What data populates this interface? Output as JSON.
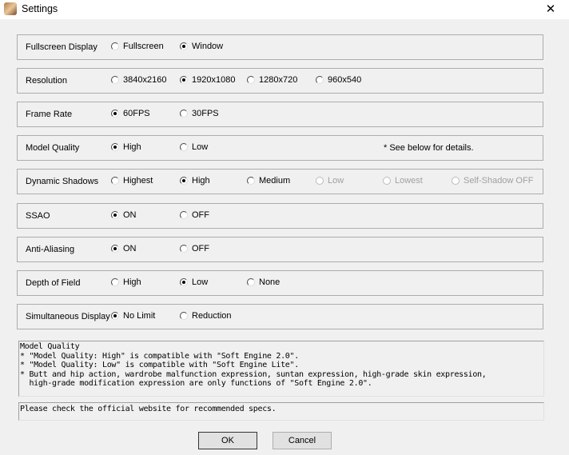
{
  "window": {
    "title": "Settings",
    "close_label": "✕"
  },
  "groups": [
    {
      "label": "Fullscreen Display",
      "options": [
        {
          "label": "Fullscreen",
          "selected": false
        },
        {
          "label": "Window",
          "selected": true
        }
      ]
    },
    {
      "label": "Resolution",
      "options": [
        {
          "label": "3840x2160",
          "selected": false
        },
        {
          "label": "1920x1080",
          "selected": true
        },
        {
          "label": "1280x720",
          "selected": false
        },
        {
          "label": "960x540",
          "selected": false
        }
      ]
    },
    {
      "label": "Frame Rate",
      "options": [
        {
          "label": "60FPS",
          "selected": true
        },
        {
          "label": "30FPS",
          "selected": false
        }
      ]
    },
    {
      "label": "Model Quality",
      "options": [
        {
          "label": "High",
          "selected": true
        },
        {
          "label": "Low",
          "selected": false
        }
      ],
      "note": "* See below for details."
    },
    {
      "label": "Dynamic Shadows",
      "options": [
        {
          "label": "Highest",
          "selected": false
        },
        {
          "label": "High",
          "selected": true
        },
        {
          "label": "Medium",
          "selected": false
        },
        {
          "label": "Low",
          "selected": false,
          "disabled": true
        },
        {
          "label": "Lowest",
          "selected": false,
          "disabled": true
        },
        {
          "label": "Self-Shadow OFF",
          "selected": false,
          "disabled": true
        }
      ]
    },
    {
      "label": "SSAO",
      "options": [
        {
          "label": "ON",
          "selected": true
        },
        {
          "label": "OFF",
          "selected": false
        }
      ]
    },
    {
      "label": "Anti-Aliasing",
      "options": [
        {
          "label": "ON",
          "selected": true
        },
        {
          "label": "OFF",
          "selected": false
        }
      ]
    },
    {
      "label": "Depth of Field",
      "options": [
        {
          "label": "High",
          "selected": false
        },
        {
          "label": "Low",
          "selected": true
        },
        {
          "label": "None",
          "selected": false
        }
      ]
    },
    {
      "label": "Simultaneous Display",
      "options": [
        {
          "label": "No Limit",
          "selected": true
        },
        {
          "label": "Reduction",
          "selected": false
        }
      ]
    }
  ],
  "details_text": "Model Quality\n* \"Model Quality: High\" is compatible with \"Soft Engine 2.0\".\n* \"Model Quality: Low\" is compatible with \"Soft Engine Lite\".\n* Butt and hip action, wardrobe malfunction expression, suntan expression, high-grade skin expression,\n  high-grade modification expression are only functions of \"Soft Engine 2.0\".",
  "specs_text": "Please check the official website for recommended specs.",
  "buttons": {
    "ok": "OK",
    "cancel": "Cancel"
  }
}
